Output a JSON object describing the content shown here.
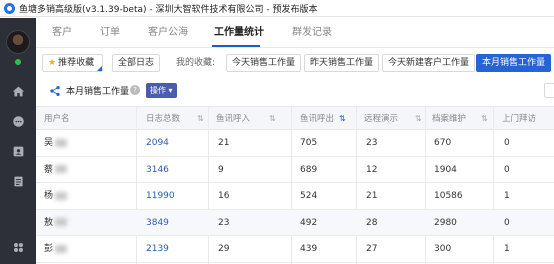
{
  "window": {
    "title": "鱼塘多销高级版(v3.1.39-beta) - 深圳大智软件技术有限公司 - 预发布版本"
  },
  "sidebar": {
    "icons": [
      "home-icon",
      "chat-icon",
      "contacts-icon",
      "document-icon",
      "grid-icon"
    ]
  },
  "nav": {
    "tabs": [
      {
        "label": "客户",
        "active": false
      },
      {
        "label": "订单",
        "active": false
      },
      {
        "label": "客户公海",
        "active": false
      },
      {
        "label": "工作量统计",
        "active": true
      },
      {
        "label": "群发记录",
        "active": false
      }
    ]
  },
  "filters": {
    "recommended_label": "推荐收藏",
    "all_log_label": "全部日志",
    "my_favorites_label": "我的收藏:",
    "fav1": "今天销售工作量",
    "fav2": "昨天销售工作量",
    "fav3": "今天新建客户工作量",
    "fav4": "本月销售工作量"
  },
  "report": {
    "title": "本月销售工作量",
    "operate_label": "操作"
  },
  "table": {
    "columns": [
      "用户名",
      "日志总数",
      "鱼讯呼入",
      "鱼讯呼出",
      "远程演示",
      "档案维护",
      "上门拜访"
    ],
    "rows": [
      {
        "name": "吴",
        "total": "2094",
        "in": "21",
        "out": "705",
        "demo": "23",
        "archive": "670",
        "visit": "0"
      },
      {
        "name": "蔡",
        "total": "3146",
        "in": "9",
        "out": "689",
        "demo": "12",
        "archive": "1904",
        "visit": "0"
      },
      {
        "name": "杨",
        "total": "11990",
        "in": "16",
        "out": "524",
        "demo": "21",
        "archive": "10586",
        "visit": "1"
      },
      {
        "name": "敖",
        "total": "3849",
        "in": "23",
        "out": "492",
        "demo": "28",
        "archive": "2980",
        "visit": "0"
      },
      {
        "name": "彭",
        "total": "2139",
        "in": "29",
        "out": "439",
        "demo": "27",
        "archive": "300",
        "visit": "1"
      }
    ]
  },
  "colors": {
    "accent": "#2563d6",
    "sidebar": "#2d3038",
    "operate_btn": "#4a5cab"
  }
}
